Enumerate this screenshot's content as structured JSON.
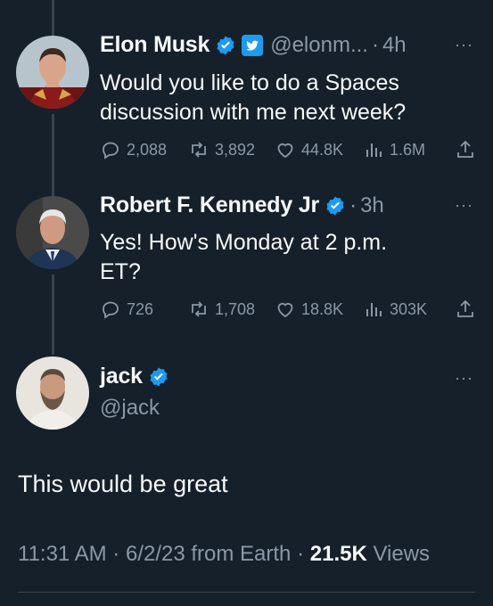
{
  "tweets": [
    {
      "name": "Elon Musk",
      "handle": "@elonm...",
      "separator": "·",
      "time": "4h",
      "text": "Would you like to do a Spaces discussion with me next week?",
      "replies": "2,088",
      "retweets": "3,892",
      "likes": "44.8K",
      "views": "1.6M",
      "badges": [
        "verified-badge-icon",
        "twitter-affiliate-icon"
      ]
    },
    {
      "name": "Robert F. Kennedy Jr",
      "separator": "·",
      "time": "3h",
      "text": "Yes! How's Monday at 2 p.m. ET?",
      "replies": "726",
      "retweets": "1,708",
      "likes": "18.8K",
      "views": "303K",
      "badges": [
        "verified-badge-icon"
      ]
    }
  ],
  "main_tweet": {
    "name": "jack",
    "handle": "@jack",
    "text": "This would be great",
    "time": "11:31 AM",
    "date": "6/2/23",
    "source": "from Earth",
    "views_count": "21.5K",
    "views_label": "Views",
    "separator": "·"
  },
  "more_label": "···",
  "colors": {
    "background": "#15202b",
    "text": "#f7f9f9",
    "secondary": "#8b98a5",
    "accent": "#1d9bf0",
    "line": "#38444d"
  },
  "icons": [
    "reply-icon",
    "retweet-icon",
    "like-icon",
    "views-icon",
    "share-icon",
    "more-icon"
  ]
}
